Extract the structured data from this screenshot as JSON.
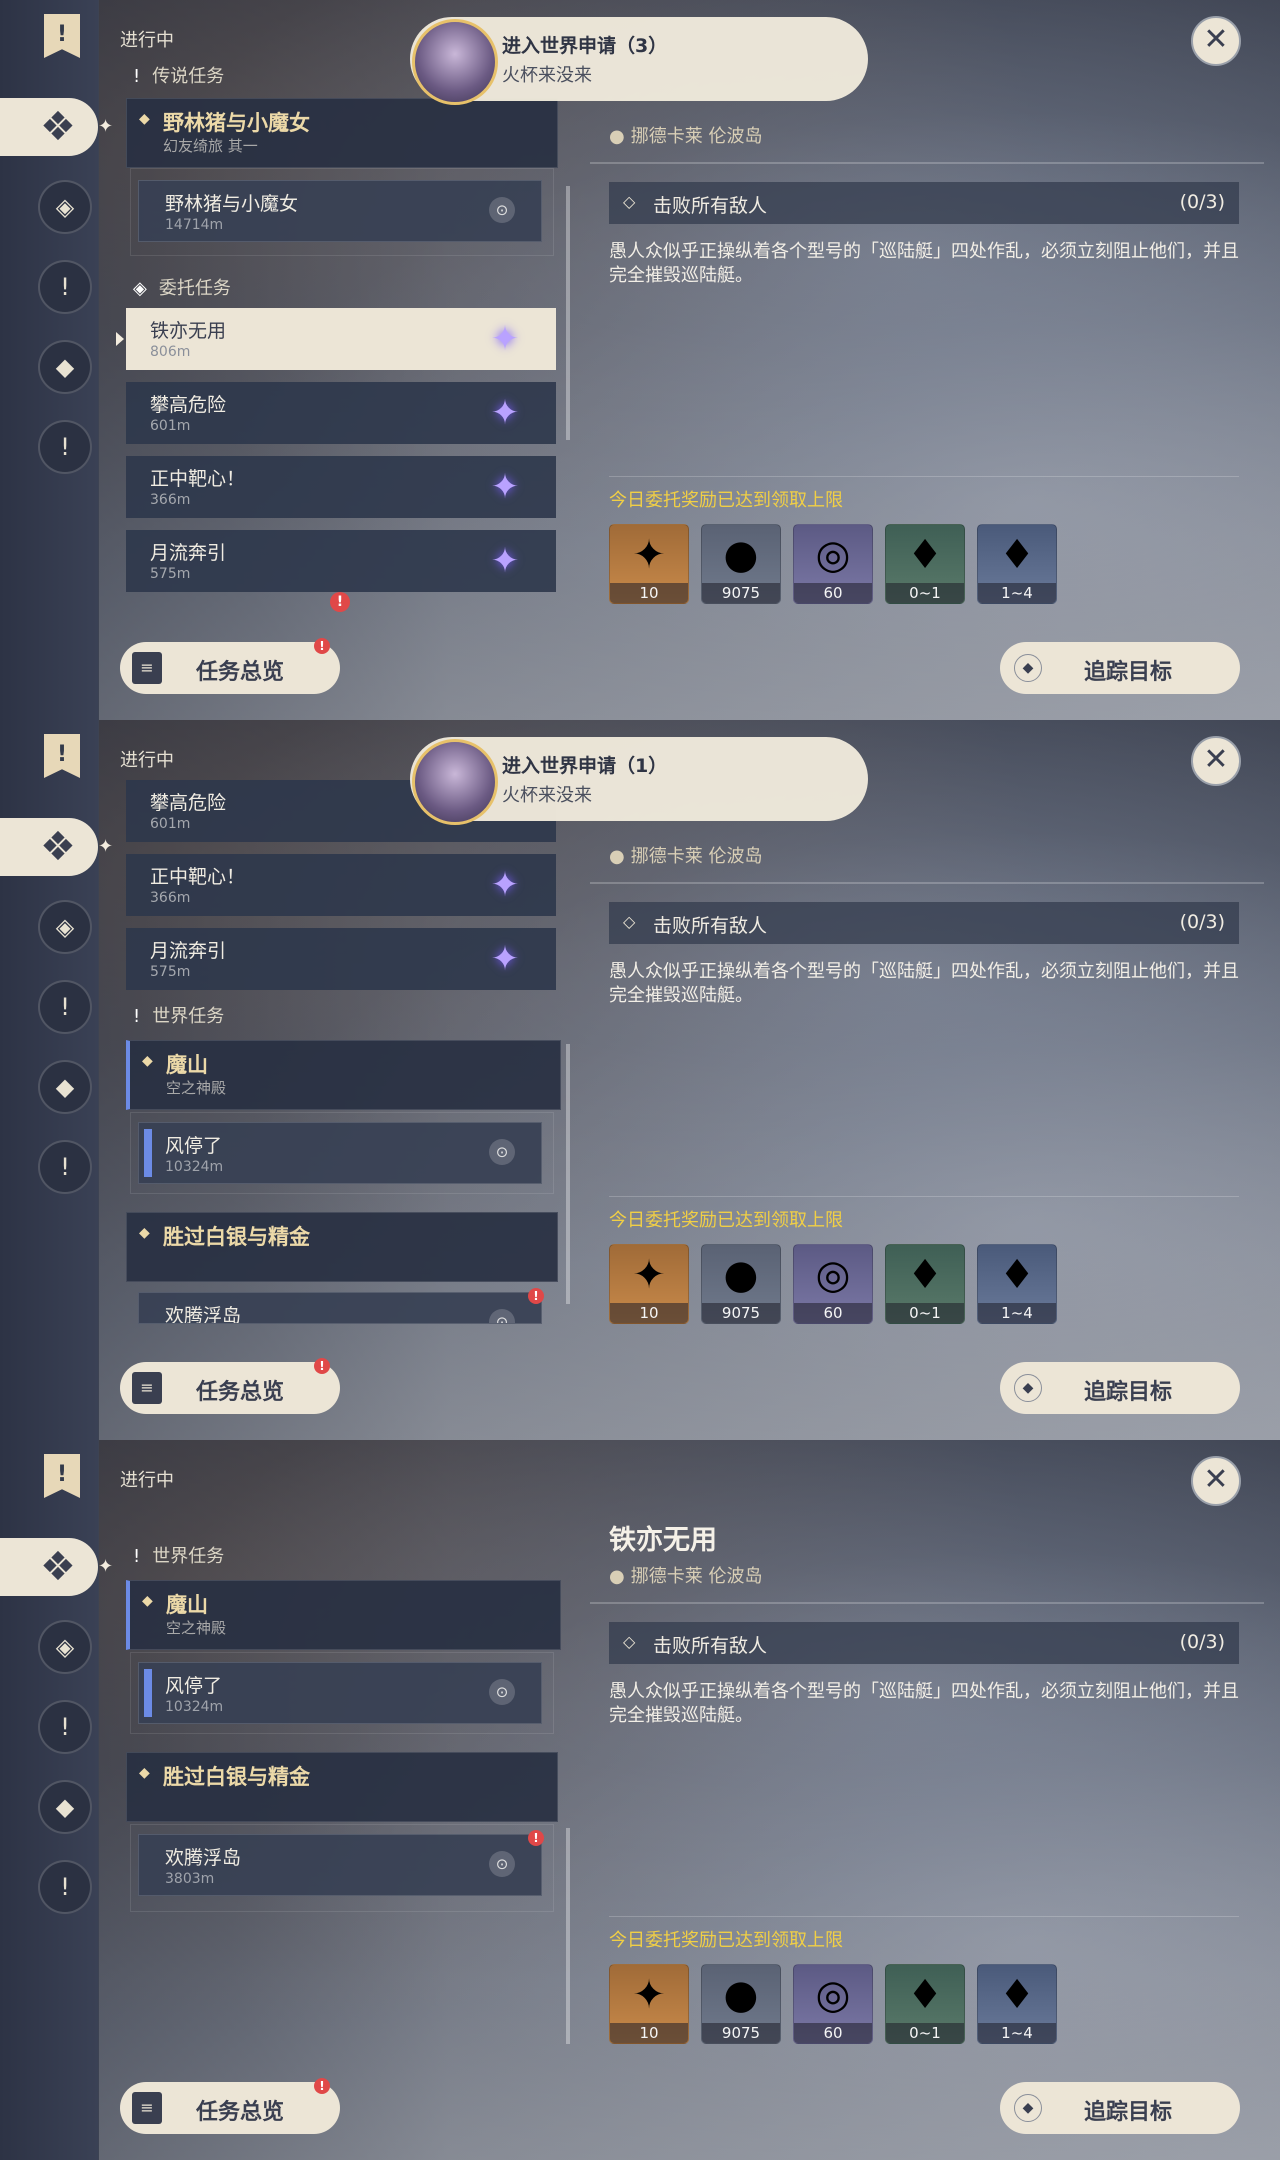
{
  "status_label": "进行中",
  "sections": {
    "legend": "传说任务",
    "commission": "委托任务",
    "world": "世界任务"
  },
  "quests": {
    "legend_group_title": "野林猪与小魔女",
    "legend_group_sub": "幻友绮旅 其一",
    "legend_sub_title": "野林猪与小魔女",
    "legend_sub_dist": "14714m",
    "commissions": [
      {
        "title": "铁亦无用",
        "dist": "806m"
      },
      {
        "title": "攀高危险",
        "dist": "601m"
      },
      {
        "title": "正中靶心！",
        "dist": "366m"
      },
      {
        "title": "月流奔引",
        "dist": "575m"
      }
    ],
    "world_group1_title": "魔山",
    "world_group1_sub": "空之神殿",
    "world_sub1_title": "风停了",
    "world_sub1_dist": "10324m",
    "world_group2_title": "胜过白银与精金",
    "world_sub2_title": "欢腾浮岛",
    "world_sub2_dist": "3803m"
  },
  "notifications": [
    {
      "title": "进入世界申请（3）",
      "sub": "火杯来没来"
    },
    {
      "title": "进入世界申请（1）",
      "sub": "火杯来没来"
    }
  ],
  "detail": {
    "title": "铁亦无用",
    "location": "挪德卡莱 伦波岛",
    "objective": "击败所有敌人",
    "objective_count": "(0/3)",
    "description": "愚人众似乎正操纵着各个型号的「巡陆艇」四处作乱，必须立刻阻止他们，并且完全摧毁巡陆艇。",
    "limit_text": "今日委托奖励已达到领取上限",
    "rewards": [
      {
        "icon": "star-icon",
        "count": "10"
      },
      {
        "icon": "mora-coin-icon",
        "count": "9075"
      },
      {
        "icon": "ring-icon",
        "count": "60"
      },
      {
        "icon": "crystal-icon",
        "count": "0~1"
      },
      {
        "icon": "crystal-cluster-icon",
        "count": "1~4"
      }
    ]
  },
  "buttons": {
    "overview": "任务总览",
    "track": "追踪目标"
  },
  "colors": {
    "accent": "#ece5d6",
    "limit_yellow": "#f1cf45",
    "quest_gold": "#ecd9a8",
    "alert_red": "#e04848"
  }
}
